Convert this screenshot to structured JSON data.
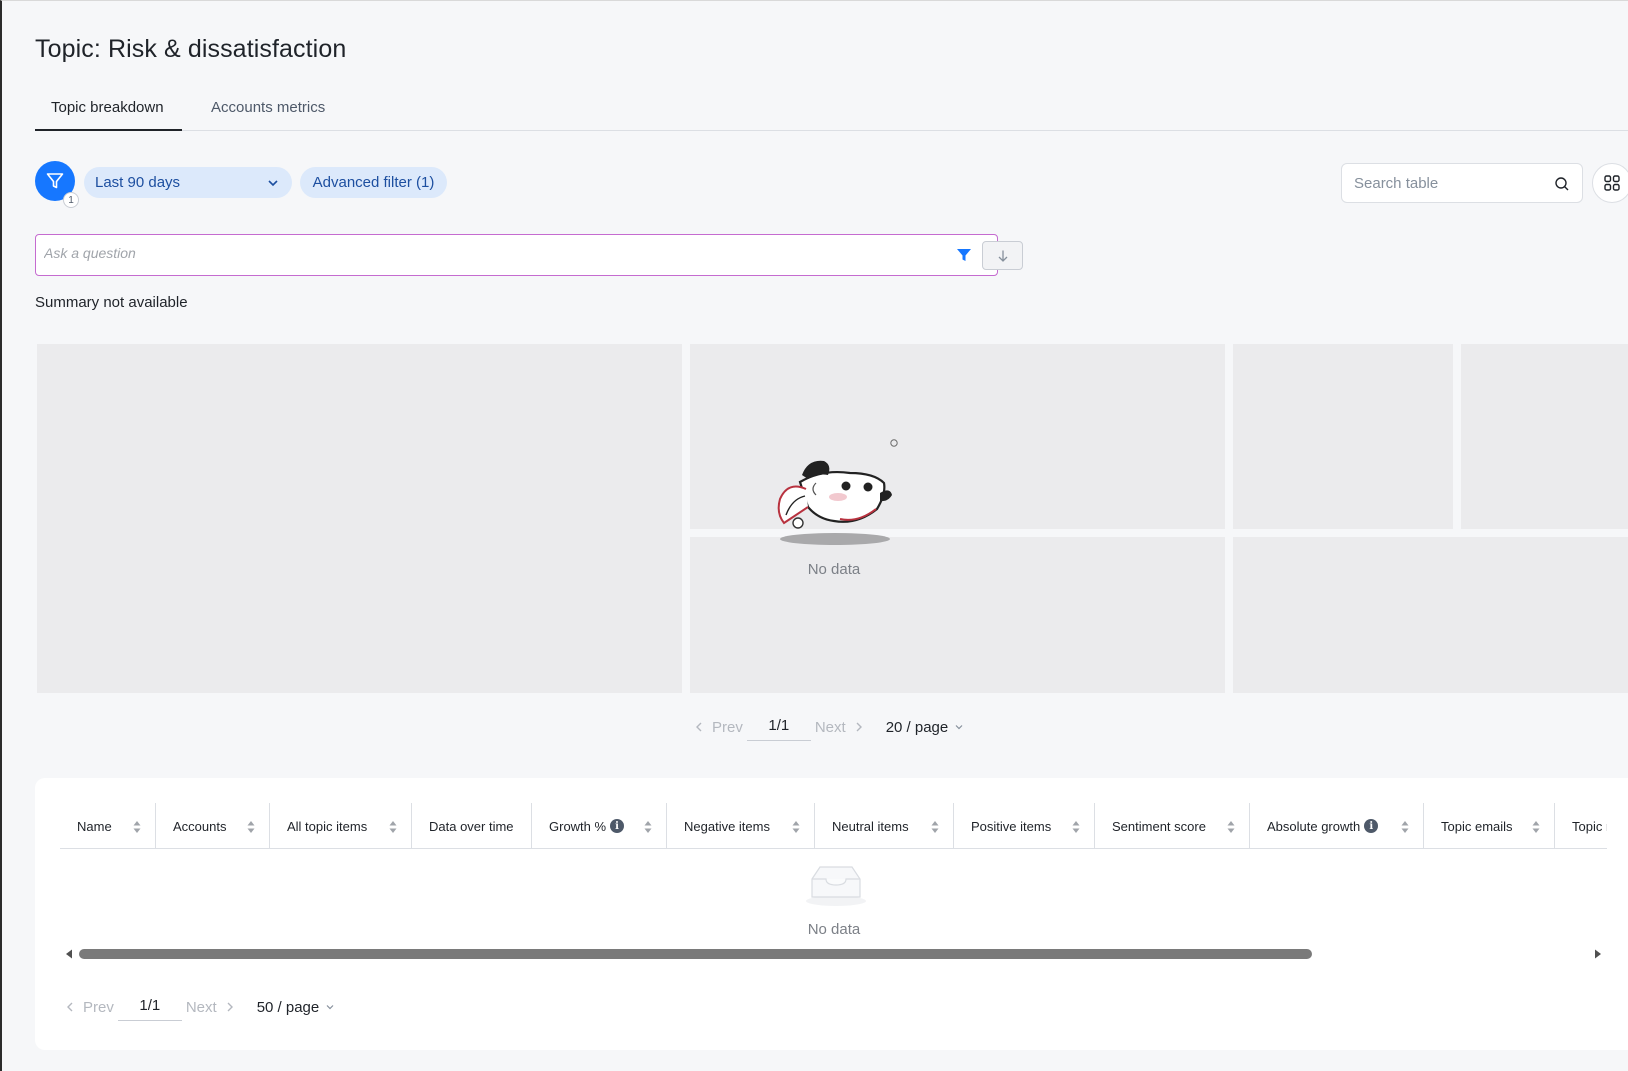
{
  "page": {
    "title": "Topic: Risk & dissatisfaction"
  },
  "tabs": [
    {
      "label": "Topic breakdown",
      "active": true
    },
    {
      "label": "Accounts metrics",
      "active": false
    }
  ],
  "filters": {
    "active_count": "1",
    "date_range": "Last 90 days",
    "advanced_filter": "Advanced filter (1)",
    "search_placeholder": "Search table"
  },
  "ask": {
    "placeholder": "Ask a question"
  },
  "summary": {
    "text": "Summary not available"
  },
  "treemap": {
    "empty_text": "No data"
  },
  "top_pager": {
    "prev": "Prev",
    "page": "1/1",
    "next": "Next",
    "page_size": "20 / page"
  },
  "table": {
    "columns": [
      {
        "label": "Name",
        "sortable": true,
        "info": false
      },
      {
        "label": "Accounts",
        "sortable": true,
        "info": false
      },
      {
        "label": "All topic items",
        "sortable": true,
        "info": false
      },
      {
        "label": "Data over time",
        "sortable": false,
        "info": false
      },
      {
        "label": "Growth %",
        "sortable": true,
        "info": true
      },
      {
        "label": "Negative items",
        "sortable": true,
        "info": false
      },
      {
        "label": "Neutral items",
        "sortable": true,
        "info": false
      },
      {
        "label": "Positive items",
        "sortable": true,
        "info": false
      },
      {
        "label": "Sentiment score",
        "sortable": true,
        "info": false
      },
      {
        "label": "Absolute growth",
        "sortable": true,
        "info": true
      },
      {
        "label": "Topic emails",
        "sortable": true,
        "info": false
      },
      {
        "label": "Topic r",
        "sortable": false,
        "info": false
      }
    ],
    "empty_text": "No data"
  },
  "bottom_pager": {
    "prev": "Prev",
    "page": "1/1",
    "next": "Next",
    "page_size": "50 / page"
  },
  "colors": {
    "accent": "#1677ff",
    "chip_bg": "#dce9fb",
    "chip_text": "#1d4fa0",
    "ask_border": "#c56bd0"
  }
}
